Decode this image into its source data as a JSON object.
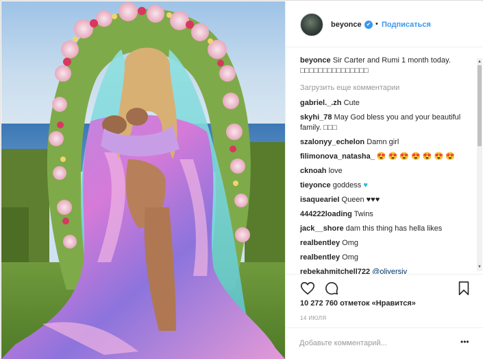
{
  "post": {
    "photo_alt": "photo",
    "header": {
      "username": "beyonce",
      "verified_mark": "✔",
      "separator": "•",
      "follow_label": "Подписаться"
    },
    "caption": {
      "username": "beyonce",
      "text": "Sir Carter and Rumi 1 month today. □□□□□□□□□□□□□□□"
    },
    "load_more_label": "Загрузить еще комментарии",
    "comments": [
      {
        "user": "gabriel._.zh",
        "text": "Cute"
      },
      {
        "user": "skyhi_78",
        "text": "May God bless you and your beautiful family. □□□"
      },
      {
        "user": "szalonyy_echelon",
        "text": "Damn girl"
      },
      {
        "user": "filimonova_natasha_",
        "text": "😍 😍 😍 😍 😍 😍 😍"
      },
      {
        "user": "cknoah",
        "text": "love"
      },
      {
        "user": "tieyonce",
        "text": "goddess",
        "emoji": "♥"
      },
      {
        "user": "isaquearieI",
        "text": "Queen ♥♥♥"
      },
      {
        "user": "444222loading",
        "text": "Twins"
      },
      {
        "user": "jack__shore",
        "text": "dam this thing has hella likes"
      },
      {
        "user": "realbentley",
        "text": "Omg"
      },
      {
        "user": "realbentley",
        "text": "Omg"
      },
      {
        "user": "rebekahmitchell722",
        "text": "@oliversiv"
      }
    ],
    "likes_label": "10 272 760 отметок «Нравится»",
    "date_label": "14 ИЮЛЯ",
    "add_comment_placeholder": "Добавьте комментарий...",
    "more_label": "•••",
    "icons": {
      "like": "heart-outline-icon",
      "comment": "speech-bubble-icon",
      "save": "bookmark-icon"
    },
    "colors": {
      "link_blue": "#3897f0",
      "text": "#262626",
      "muted": "#999999",
      "border": "#efefef"
    }
  }
}
